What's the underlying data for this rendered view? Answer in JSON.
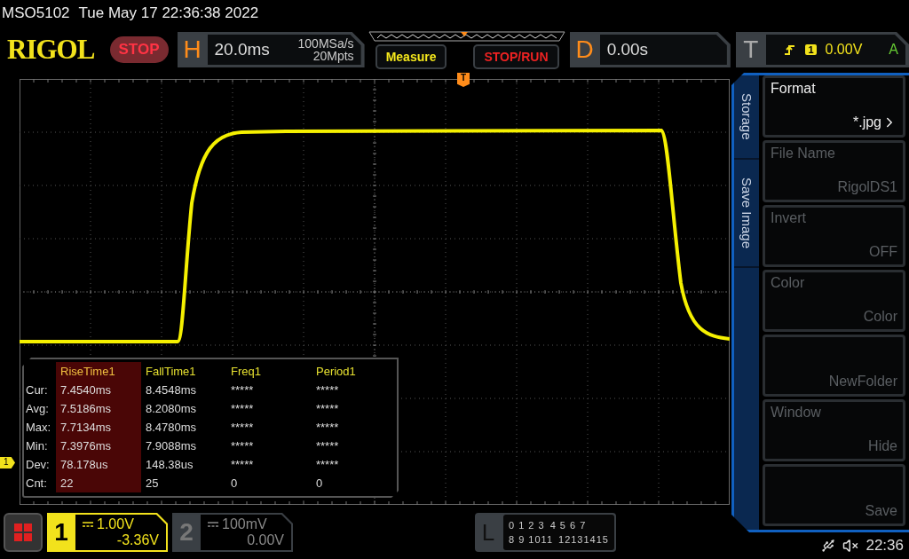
{
  "status_line": {
    "model": "MSO5102",
    "datetime": "Tue May 17 22:36:38 2022"
  },
  "header": {
    "logo": "RIGOL",
    "run_state": "STOP",
    "horizontal": {
      "label": "H",
      "timebase": "20.0ms",
      "sample_rate": "100MSa/s",
      "memory_depth": "20Mpts"
    },
    "buttons": [
      {
        "label": "Measure",
        "kind": "measure"
      },
      {
        "label": "STOP/RUN",
        "kind": "run"
      }
    ],
    "delay": {
      "label": "D",
      "value": "0.00s"
    },
    "trigger": {
      "label": "T",
      "source": "1",
      "level": "0.00V",
      "mode": "A"
    }
  },
  "trigger_marker": "T",
  "channel_marker": "1",
  "measurements": {
    "columns": [
      {
        "label": "RiseTime1",
        "selected": true
      },
      {
        "label": "FallTime1",
        "selected": false
      },
      {
        "label": "Freq1",
        "selected": false
      },
      {
        "label": "Period1",
        "selected": false
      }
    ],
    "rows": [
      {
        "label": "Cur:",
        "cells": [
          "7.4540ms",
          "8.4548ms",
          "*****",
          "*****"
        ]
      },
      {
        "label": "Avg:",
        "cells": [
          "7.5186ms",
          "8.2080ms",
          "*****",
          "*****"
        ]
      },
      {
        "label": "Max:",
        "cells": [
          "7.7134ms",
          "8.4780ms",
          "*****",
          "*****"
        ]
      },
      {
        "label": "Min:",
        "cells": [
          "7.3976ms",
          "7.9088ms",
          "*****",
          "*****"
        ]
      },
      {
        "label": "Dev:",
        "cells": [
          "78.178us",
          "148.38us",
          "*****",
          "*****"
        ]
      },
      {
        "label": "Cnt:",
        "cells": [
          "22",
          "25",
          "0",
          "0"
        ]
      }
    ]
  },
  "menu": {
    "tabs": [
      {
        "label": "Storage"
      },
      {
        "label": "Save Image"
      }
    ],
    "items": [
      {
        "label": "Format",
        "value": "*.jpg",
        "enabled": true,
        "submenu": true
      },
      {
        "label": "File Name",
        "value": "RigolDS1",
        "enabled": false,
        "submenu": false
      },
      {
        "label": "Invert",
        "value": "OFF",
        "enabled": false,
        "submenu": false
      },
      {
        "label": "Color",
        "value": "Color",
        "enabled": false,
        "submenu": false
      },
      {
        "value": "NewFolder",
        "enabled": false,
        "submenu": false
      },
      {
        "label": "Window",
        "value": "Hide",
        "enabled": false,
        "submenu": false
      },
      {
        "value": "Save",
        "enabled": false,
        "submenu": false
      }
    ]
  },
  "channels": [
    {
      "number": "1",
      "scale": "1.00V",
      "offset": "-3.36V",
      "selected": true
    },
    {
      "number": "2",
      "scale": "100mV",
      "offset": "0.00V",
      "selected": false
    }
  ],
  "logic": {
    "label": "L",
    "rows": [
      [
        "0 1 2 3",
        "4 5 6 7"
      ],
      [
        "8 9 1011",
        "12131415"
      ]
    ]
  },
  "status_bar": {
    "time": "22:36"
  }
}
